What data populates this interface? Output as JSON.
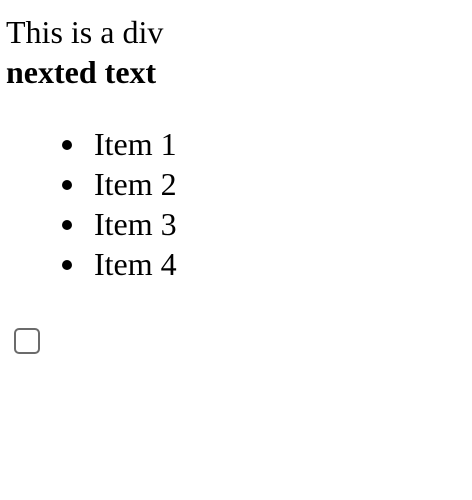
{
  "content": {
    "div_text": "This is a div",
    "nested_text": "nexted text",
    "list_items": [
      "Item 1",
      "Item 2",
      "Item 3",
      "Item 4"
    ],
    "checkbox": {
      "checked": false
    }
  },
  "colors": {
    "text": "#000000",
    "background": "#ffffff",
    "checkbox_border": "#6b6b6b"
  }
}
